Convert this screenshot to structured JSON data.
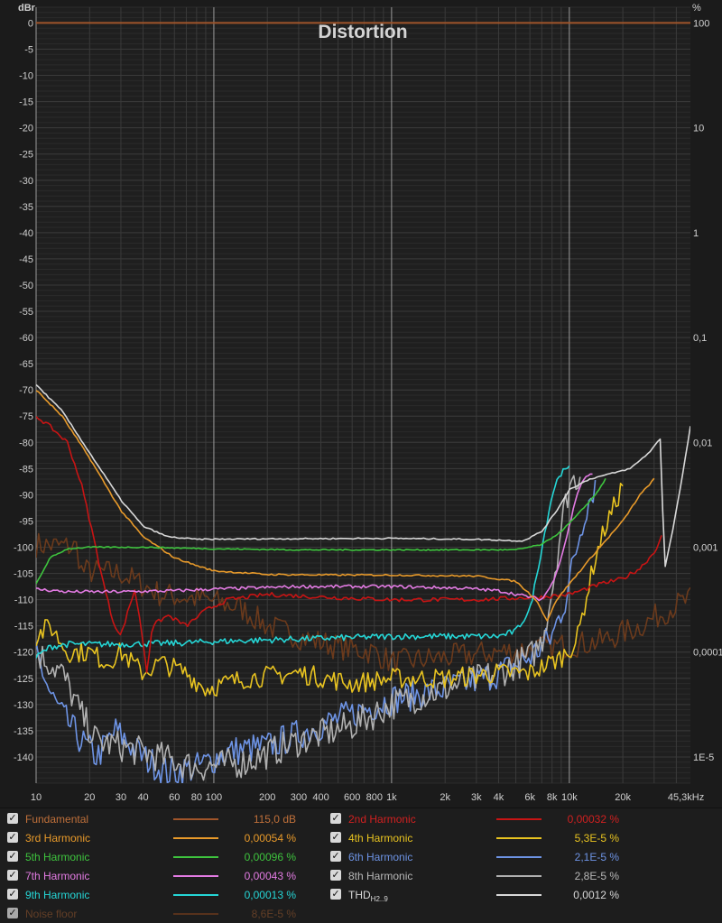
{
  "chart_data": {
    "type": "line",
    "title": "Distortion",
    "ylabel_left": "dBr",
    "ylabel_right": "%",
    "x_scale": "log",
    "xlim": [
      10,
      48000
    ],
    "ylim": [
      -145,
      3
    ],
    "x_ticks": [
      {
        "v": 10,
        "label": "10"
      },
      {
        "v": 20,
        "label": "20"
      },
      {
        "v": 30,
        "label": "30"
      },
      {
        "v": 40,
        "label": "40"
      },
      {
        "v": 60,
        "label": "60"
      },
      {
        "v": 80,
        "label": "80"
      },
      {
        "v": 100,
        "label": "100"
      },
      {
        "v": 200,
        "label": "200"
      },
      {
        "v": 300,
        "label": "300"
      },
      {
        "v": 400,
        "label": "400"
      },
      {
        "v": 600,
        "label": "600"
      },
      {
        "v": 800,
        "label": "800"
      },
      {
        "v": 1000,
        "label": "1k"
      },
      {
        "v": 2000,
        "label": "2k"
      },
      {
        "v": 3000,
        "label": "3k"
      },
      {
        "v": 4000,
        "label": "4k"
      },
      {
        "v": 6000,
        "label": "6k"
      },
      {
        "v": 8000,
        "label": "8k"
      },
      {
        "v": 10000,
        "label": "10k"
      },
      {
        "v": 20000,
        "label": "20k"
      },
      {
        "v": 45300,
        "label": "45,3kHz"
      }
    ],
    "y_ticks": [
      "0",
      "-5",
      "-10",
      "-15",
      "-20",
      "-25",
      "-30",
      "-35",
      "-40",
      "-45",
      "-50",
      "-55",
      "-60",
      "-65",
      "-70",
      "-75",
      "-80",
      "-85",
      "-90",
      "-95",
      "-100",
      "-105",
      "-110",
      "-115",
      "-120",
      "-125",
      "-130",
      "-135",
      "-140"
    ],
    "y_ticks_values": [
      0,
      -5,
      -10,
      -15,
      -20,
      -25,
      -30,
      -35,
      -40,
      -45,
      -50,
      -55,
      -60,
      -65,
      -70,
      -75,
      -80,
      -85,
      -90,
      -95,
      -100,
      -105,
      -110,
      -115,
      -120,
      -125,
      -130,
      -135,
      -140
    ],
    "right_ticks": [
      {
        "db": 0,
        "label": "100"
      },
      {
        "db": -20,
        "label": "10"
      },
      {
        "db": -40,
        "label": "1"
      },
      {
        "db": -60,
        "label": "0,1"
      },
      {
        "db": -80,
        "label": "0,01"
      },
      {
        "db": -100,
        "label": "0,001"
      },
      {
        "db": -120,
        "label": "0,0001"
      },
      {
        "db": -140,
        "label": "1E-5"
      }
    ],
    "grid": true,
    "series": [
      {
        "name": "Fundamental",
        "color": "#a0552a",
        "value": "115,0 dB",
        "points": [
          [
            10,
            0
          ],
          [
            48000,
            0
          ]
        ]
      },
      {
        "name": "Noise floor",
        "color": "#6b3a1c",
        "value": "8,6E-5 %",
        "noisy": 2.5,
        "points": [
          [
            10,
            -99.5
          ],
          [
            17,
            -100
          ],
          [
            18,
            -104.5
          ],
          [
            30,
            -105
          ],
          [
            50,
            -109
          ],
          [
            90,
            -110
          ],
          [
            140,
            -111.5
          ],
          [
            200,
            -115
          ],
          [
            300,
            -117
          ],
          [
            500,
            -119
          ],
          [
            800,
            -120
          ],
          [
            1000,
            -122
          ],
          [
            2000,
            -121
          ],
          [
            4000,
            -120
          ],
          [
            8000,
            -119
          ],
          [
            15000,
            -118
          ],
          [
            25000,
            -115
          ],
          [
            40000,
            -111
          ],
          [
            48000,
            -110
          ]
        ]
      },
      {
        "name": "2nd Harmonic",
        "color": "#c81414",
        "value": "0,00032 %",
        "noisy": 0.4,
        "points": [
          [
            10,
            -75
          ],
          [
            12,
            -77
          ],
          [
            15,
            -80
          ],
          [
            18,
            -88
          ],
          [
            21,
            -98
          ],
          [
            24,
            -107
          ],
          [
            27,
            -114
          ],
          [
            30,
            -117
          ],
          [
            33,
            -112
          ],
          [
            36,
            -108
          ],
          [
            40,
            -118
          ],
          [
            42,
            -124
          ],
          [
            45,
            -115
          ],
          [
            55,
            -113
          ],
          [
            70,
            -115
          ],
          [
            90,
            -112
          ],
          [
            120,
            -110
          ],
          [
            200,
            -109
          ],
          [
            400,
            -109.5
          ],
          [
            1000,
            -110
          ],
          [
            3000,
            -110
          ],
          [
            7000,
            -109.5
          ],
          [
            10000,
            -109
          ],
          [
            15000,
            -107
          ],
          [
            20000,
            -106
          ],
          [
            25000,
            -104
          ],
          [
            30000,
            -101
          ],
          [
            33000,
            -98
          ]
        ]
      },
      {
        "name": "3rd Harmonic",
        "color": "#e89a2a",
        "value": "0,00054 %",
        "noisy": 0.15,
        "points": [
          [
            10,
            -70
          ],
          [
            14,
            -75
          ],
          [
            20,
            -83
          ],
          [
            30,
            -93
          ],
          [
            40,
            -98
          ],
          [
            60,
            -102
          ],
          [
            80,
            -103.5
          ],
          [
            100,
            -104.5
          ],
          [
            200,
            -105.2
          ],
          [
            500,
            -105.3
          ],
          [
            1000,
            -105.3
          ],
          [
            3000,
            -105.5
          ],
          [
            5000,
            -106.5
          ],
          [
            6500,
            -110
          ],
          [
            7500,
            -114
          ],
          [
            8500,
            -110
          ],
          [
            10000,
            -107
          ],
          [
            14000,
            -101
          ],
          [
            20000,
            -95
          ],
          [
            25000,
            -90
          ],
          [
            30000,
            -87
          ]
        ]
      },
      {
        "name": "4th Harmonic",
        "color": "#e8c320",
        "value": "5,3E-5 %",
        "noisy": 2.0,
        "points": [
          [
            10,
            -117
          ],
          [
            12,
            -115
          ],
          [
            15,
            -120
          ],
          [
            20,
            -120
          ],
          [
            25,
            -122
          ],
          [
            30,
            -120
          ],
          [
            40,
            -124
          ],
          [
            50,
            -122
          ],
          [
            70,
            -124
          ],
          [
            90,
            -127
          ],
          [
            150,
            -125
          ],
          [
            300,
            -124
          ],
          [
            600,
            -126
          ],
          [
            1000,
            -125
          ],
          [
            2000,
            -125
          ],
          [
            4000,
            -124
          ],
          [
            6000,
            -124
          ],
          [
            9000,
            -121
          ],
          [
            11000,
            -118
          ],
          [
            12000,
            -112
          ],
          [
            14000,
            -102
          ],
          [
            16000,
            -96
          ],
          [
            18000,
            -92
          ],
          [
            20000,
            -88
          ]
        ]
      },
      {
        "name": "5th Harmonic",
        "color": "#3ec43e",
        "value": "0,00096 %",
        "noisy": 0.12,
        "points": [
          [
            10,
            -107
          ],
          [
            12,
            -102
          ],
          [
            15,
            -100.3
          ],
          [
            20,
            -100
          ],
          [
            40,
            -100
          ],
          [
            100,
            -100.3
          ],
          [
            300,
            -100.5
          ],
          [
            1000,
            -100.5
          ],
          [
            3000,
            -100.5
          ],
          [
            5000,
            -100.5
          ],
          [
            7000,
            -99.5
          ],
          [
            9000,
            -97
          ],
          [
            11000,
            -94
          ],
          [
            14000,
            -90
          ],
          [
            16000,
            -87
          ]
        ]
      },
      {
        "name": "6th Harmonic",
        "color": "#6d93e4",
        "value": "2,1E-5 %",
        "noisy": 3.0,
        "points": [
          [
            10,
            -120
          ],
          [
            12,
            -128
          ],
          [
            14,
            -132
          ],
          [
            18,
            -137
          ],
          [
            22,
            -140
          ],
          [
            28,
            -135
          ],
          [
            40,
            -140
          ],
          [
            55,
            -143
          ],
          [
            80,
            -142
          ],
          [
            120,
            -139
          ],
          [
            200,
            -138
          ],
          [
            400,
            -134
          ],
          [
            700,
            -131
          ],
          [
            1000,
            -129
          ],
          [
            2000,
            -127
          ],
          [
            4000,
            -124
          ],
          [
            6000,
            -121
          ],
          [
            8000,
            -117
          ],
          [
            9500,
            -110
          ],
          [
            11000,
            -100
          ],
          [
            12500,
            -92
          ],
          [
            14000,
            -88
          ]
        ]
      },
      {
        "name": "7th Harmonic",
        "color": "#e37be3",
        "value": "0,00043 %",
        "noisy": 0.3,
        "points": [
          [
            10,
            -108
          ],
          [
            15,
            -108.5
          ],
          [
            30,
            -108.5
          ],
          [
            60,
            -108.3
          ],
          [
            100,
            -108
          ],
          [
            300,
            -107.5
          ],
          [
            1000,
            -107.5
          ],
          [
            2500,
            -107.8
          ],
          [
            4000,
            -108.3
          ],
          [
            6000,
            -109.5
          ],
          [
            7000,
            -110
          ],
          [
            8000,
            -107
          ],
          [
            9000,
            -102
          ],
          [
            10000,
            -96
          ],
          [
            11000,
            -90
          ],
          [
            12000,
            -87
          ],
          [
            13500,
            -86
          ]
        ]
      },
      {
        "name": "8th Harmonic",
        "color": "#b0b0b0",
        "value": "2,8E-5 %",
        "noisy": 3.0,
        "points": [
          [
            10,
            -120
          ],
          [
            14,
            -124
          ],
          [
            18,
            -132
          ],
          [
            22,
            -137
          ],
          [
            30,
            -138
          ],
          [
            50,
            -140
          ],
          [
            80,
            -142
          ],
          [
            150,
            -141
          ],
          [
            300,
            -137
          ],
          [
            600,
            -134
          ],
          [
            1000,
            -130
          ],
          [
            2000,
            -127
          ],
          [
            4000,
            -124
          ],
          [
            6000,
            -121
          ],
          [
            7000,
            -118
          ],
          [
            8000,
            -108
          ],
          [
            9000,
            -96
          ],
          [
            10000,
            -88
          ],
          [
            11500,
            -86
          ]
        ]
      },
      {
        "name": "9th Harmonic",
        "color": "#25d6d6",
        "value": "0,00013 %",
        "noisy": 0.6,
        "points": [
          [
            10,
            -121
          ],
          [
            12,
            -119
          ],
          [
            15,
            -118.5
          ],
          [
            30,
            -118.5
          ],
          [
            60,
            -118.3
          ],
          [
            100,
            -118
          ],
          [
            300,
            -117.5
          ],
          [
            1000,
            -117
          ],
          [
            2000,
            -117
          ],
          [
            4000,
            -117
          ],
          [
            5000,
            -116
          ],
          [
            6000,
            -112
          ],
          [
            6500,
            -106
          ],
          [
            7200,
            -98
          ],
          [
            8000,
            -90
          ],
          [
            8800,
            -86
          ],
          [
            10000,
            -85
          ]
        ]
      },
      {
        "name": "THD",
        "name_sub": "H2..9",
        "color": "#d8d8d8",
        "value": "0,0012 %",
        "noisy": 0.12,
        "points": [
          [
            10,
            -69
          ],
          [
            14,
            -74
          ],
          [
            20,
            -82
          ],
          [
            30,
            -91
          ],
          [
            40,
            -96
          ],
          [
            55,
            -98
          ],
          [
            80,
            -98.5
          ],
          [
            200,
            -98.4
          ],
          [
            1000,
            -98.3
          ],
          [
            3000,
            -98.5
          ],
          [
            5500,
            -98.8
          ],
          [
            7000,
            -97
          ],
          [
            8500,
            -93
          ],
          [
            10000,
            -89
          ],
          [
            13000,
            -87
          ],
          [
            17000,
            -86
          ],
          [
            22000,
            -85
          ],
          [
            28000,
            -82
          ],
          [
            33000,
            -79
          ],
          [
            34000,
            -105
          ],
          [
            38000,
            -97
          ],
          [
            43000,
            -87
          ],
          [
            48000,
            -77
          ]
        ]
      }
    ]
  },
  "legend_layout_order": [
    "Fundamental",
    "2nd Harmonic",
    "3rd Harmonic",
    "4th Harmonic",
    "5th Harmonic",
    "6th Harmonic",
    "7th Harmonic",
    "8th Harmonic",
    "9th Harmonic",
    "THD",
    "Noise floor"
  ],
  "legend": [
    {
      "name": "Fundamental",
      "value": "115,0 dB",
      "color": "#a0552a",
      "text_color": "#c0703a",
      "value_color": "#c0703a",
      "dim": false
    },
    {
      "name": "2nd Harmonic",
      "value": "0,00032 %",
      "color": "#c81414",
      "text_color": "#d02020",
      "value_color": "#d02020",
      "dim": false
    },
    {
      "name": "3rd Harmonic",
      "value": "0,00054 %",
      "color": "#e89a2a",
      "text_color": "#e89a2a",
      "value_color": "#e89a2a",
      "dim": false
    },
    {
      "name": "4th Harmonic",
      "value": "5,3E-5 %",
      "color": "#e8c320",
      "text_color": "#e8c320",
      "value_color": "#e8c320",
      "dim": false
    },
    {
      "name": "5th Harmonic",
      "value": "0,00096 %",
      "color": "#3ec43e",
      "text_color": "#3ec43e",
      "value_color": "#3ec43e",
      "dim": false
    },
    {
      "name": "6th Harmonic",
      "value": "2,1E-5 %",
      "color": "#6d93e4",
      "text_color": "#6d93e4",
      "value_color": "#6d93e4",
      "dim": false
    },
    {
      "name": "7th Harmonic",
      "value": "0,00043 %",
      "color": "#e37be3",
      "text_color": "#e37be3",
      "value_color": "#e37be3",
      "dim": false
    },
    {
      "name": "8th Harmonic",
      "value": "2,8E-5 %",
      "color": "#b0b0b0",
      "text_color": "#b8b8b8",
      "value_color": "#b8b8b8",
      "dim": false
    },
    {
      "name": "9th Harmonic",
      "value": "0,00013 %",
      "color": "#25d6d6",
      "text_color": "#25d6d6",
      "value_color": "#25d6d6",
      "dim": false
    },
    {
      "name": "THD",
      "name_sub": "H2..9",
      "value": "0,0012 %",
      "color": "#d8d8d8",
      "text_color": "#d8d8d8",
      "value_color": "#d8d8d8",
      "dim": false
    },
    {
      "name": "Noise floor",
      "value": "8,6E-5 %",
      "color": "#6b3a1c",
      "text_color": "#7a4a2a",
      "value_color": "#7a4a2a",
      "dim": true
    }
  ],
  "checkbox_glyph": "✓",
  "colors": {
    "background": "#1b1b1b",
    "plot_bg": "#1f1f1f",
    "grid": "#3a3a3a",
    "grid_major": "#9a9a9a",
    "axis_text": "#d0d0d0"
  }
}
